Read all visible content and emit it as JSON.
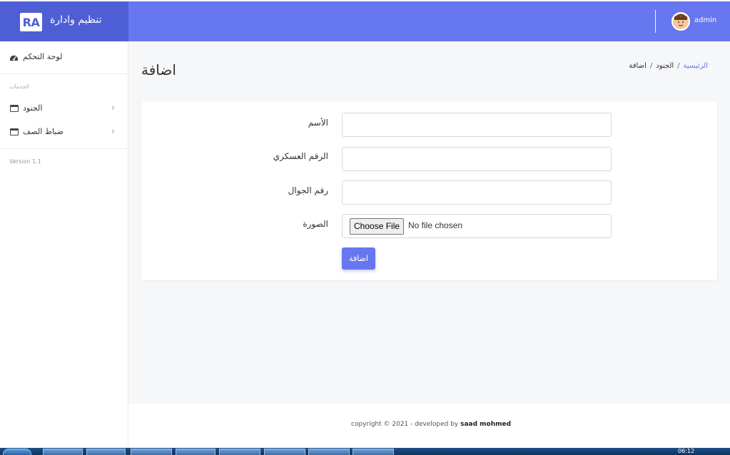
{
  "brand": {
    "logo_text": "RA",
    "title": "تنظيم وادارة"
  },
  "sidebar": {
    "dashboard": {
      "label": "لوحة التحكم",
      "icon": "dashboard-icon"
    },
    "section_title": "الخدمات",
    "items": [
      {
        "label": "الجنود",
        "icon": "window-icon"
      },
      {
        "label": "ضباط الصف",
        "icon": "window-icon"
      }
    ],
    "version": "Version 1.1"
  },
  "topbar": {
    "user_name": "admin",
    "avatar_icon": "user-avatar"
  },
  "page": {
    "title": "اضافة",
    "breadcrumb": {
      "home": "الرئيسية",
      "section": "الجنود",
      "current": "اضافة",
      "separator": "/"
    }
  },
  "form": {
    "name_label": "الأسم",
    "name_value": "",
    "military_number_label": "الرقم العسكري",
    "military_number_value": "",
    "mobile_label": "رقم الجوال",
    "mobile_value": "",
    "photo_label": "الصورة",
    "file_button": "Choose File",
    "file_status": "No file chosen",
    "submit_label": "اضافة"
  },
  "footer": {
    "text": "copyright © 2021 - developed by ",
    "author": "saad mohmed"
  },
  "taskbar": {
    "clock": "06:12"
  },
  "colors": {
    "primary": "#6777ef",
    "brand_bg": "#4e5fd6",
    "content_bg": "#f6f7f9"
  }
}
